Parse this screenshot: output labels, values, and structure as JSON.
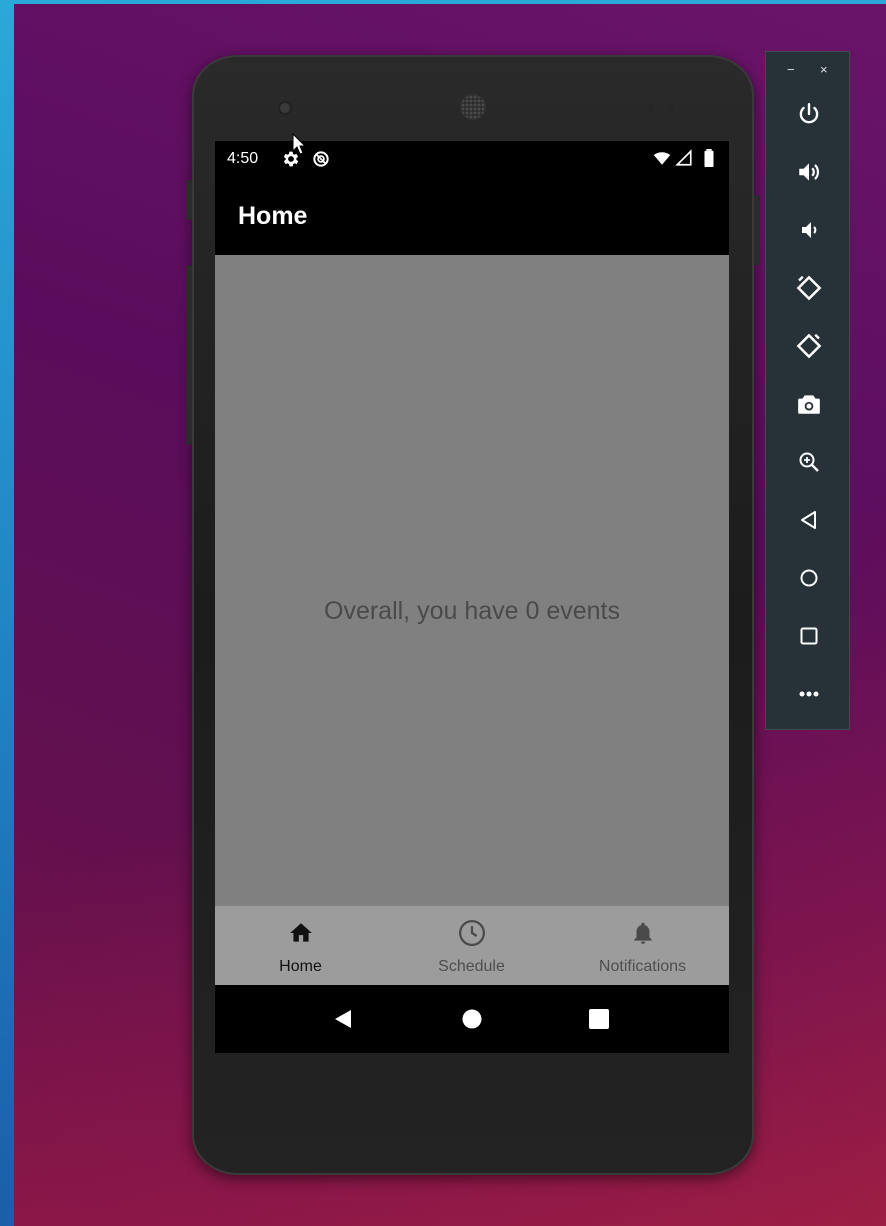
{
  "status_bar": {
    "time": "4:50"
  },
  "app_bar": {
    "title": "Home"
  },
  "content": {
    "message": "Overall, you have 0 events"
  },
  "bottom_nav": {
    "items": [
      {
        "label": "Home",
        "icon": "home-icon",
        "active": true
      },
      {
        "label": "Schedule",
        "icon": "clock-icon",
        "active": false
      },
      {
        "label": "Notifications",
        "icon": "bell-icon",
        "active": false
      }
    ]
  },
  "emulator_toolbar": {
    "minimize": "−",
    "close": "×",
    "buttons": [
      "power-icon",
      "volume-up-icon",
      "volume-down-icon",
      "rotate-left-icon",
      "rotate-right-icon",
      "camera-icon",
      "zoom-icon",
      "back-icon",
      "home-circle-icon",
      "overview-icon",
      "more-icon"
    ]
  },
  "colors": {
    "screen_content": "#808080",
    "bottom_nav": "#9c9c9c",
    "toolbar": "#263238"
  }
}
